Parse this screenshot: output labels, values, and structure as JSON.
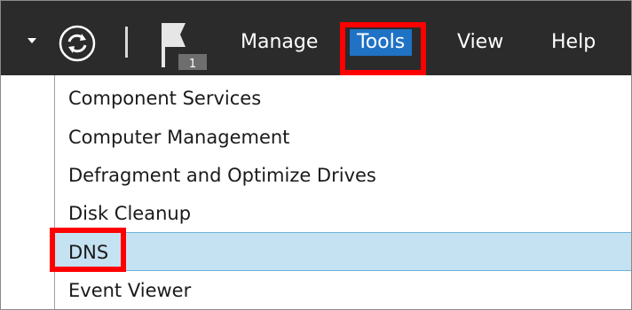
{
  "menu": {
    "items": [
      {
        "label": "Manage"
      },
      {
        "label": "Tools",
        "active": true
      },
      {
        "label": "View"
      },
      {
        "label": "Help"
      }
    ],
    "notification_count": "1",
    "icons": [
      "dropdown-arrow-icon",
      "refresh-icon",
      "notification-flag-icon"
    ]
  },
  "dropdown": {
    "items": [
      {
        "label": "Component Services"
      },
      {
        "label": "Computer Management"
      },
      {
        "label": "Defragment and Optimize Drives"
      },
      {
        "label": "Disk Cleanup"
      },
      {
        "label": "DNS",
        "selected": true
      },
      {
        "label": "Event Viewer"
      }
    ]
  },
  "colors": {
    "menubar_bg": "#2b2b2b",
    "active_menu_bg": "#1f72c4",
    "selected_item_bg": "#c5e2f2",
    "annotation_red": "#ff0000"
  }
}
